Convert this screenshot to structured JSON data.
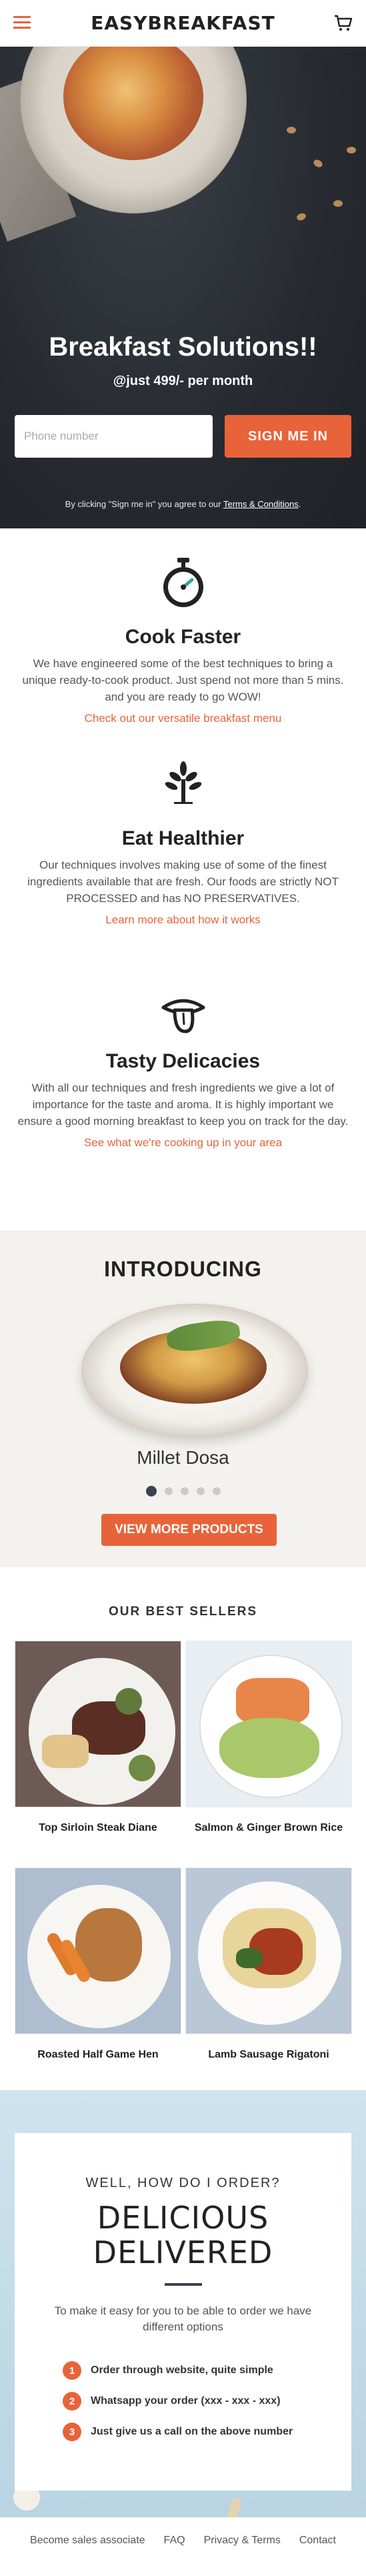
{
  "header": {
    "brand": "EASYBREAKFAST",
    "menu_icon": "hamburger-menu-icon",
    "cart_icon": "shopping-cart-icon"
  },
  "hero": {
    "title": "Breakfast Solutions!!",
    "subtitle": "@just 499/- per month",
    "phone_placeholder": "Phone number",
    "cta_label": "SIGN ME IN",
    "terms_prefix": "By clicking \"Sign me in\" you agree to our ",
    "terms_link": "Terms & Conditions",
    "terms_suffix": "."
  },
  "features": [
    {
      "icon": "stopwatch-icon",
      "title": "Cook Faster",
      "desc": "We have engineered some of the best techniques to bring a unique ready-to-cook product. Just spend not more than 5 mins. and you are ready to go WOW!",
      "link": "Check out our versatile breakfast menu"
    },
    {
      "icon": "plant-icon",
      "title": "Eat Healthier",
      "desc": "Our techniques involves making use of some of the finest ingredients available that are fresh. Our foods are strictly NOT PROCESSED and has NO PRESERVATIVES.",
      "link": "Learn more about how it works"
    },
    {
      "icon": "tongue-lips-icon",
      "title": "Tasty Delicacies",
      "desc": "With all our techniques and fresh ingredients we give a lot of importance for the taste and aroma. It is highly important we ensure a good morning breakfast to keep you on track for the day.",
      "link": "See what we're cooking up in your area"
    }
  ],
  "introducing": {
    "title": "INTRODUCING",
    "product_name": "Millet Dosa",
    "slide_count": 5,
    "active_slide": 1,
    "button_label": "VIEW MORE PRODUCTS"
  },
  "best_sellers": {
    "title": "OUR BEST SELLERS",
    "items": [
      {
        "name": "Top Sirloin Steak Diane"
      },
      {
        "name": "Salmon & Ginger Brown Rice"
      },
      {
        "name": "Roasted Half Game Hen"
      },
      {
        "name": "Lamb Sausage Rigatoni"
      }
    ]
  },
  "order": {
    "question": "WELL, HOW DO I ORDER?",
    "heading_line1": "DELICIOUS",
    "heading_line2": "DELIVERED",
    "desc": "To make it easy for you to be able to order we have different options",
    "steps": [
      {
        "num": "1",
        "text": "Order through website, quite simple"
      },
      {
        "num": "2",
        "text": "Whatsapp your order (xxx - xxx - xxx)"
      },
      {
        "num": "3",
        "text": "Just give us a call on the above number"
      }
    ]
  },
  "footer": {
    "links": [
      "Become sales associate",
      "FAQ",
      "Privacy & Terms",
      "Contact"
    ]
  },
  "colors": {
    "accent": "#e8633a",
    "dark": "#3a4350"
  }
}
